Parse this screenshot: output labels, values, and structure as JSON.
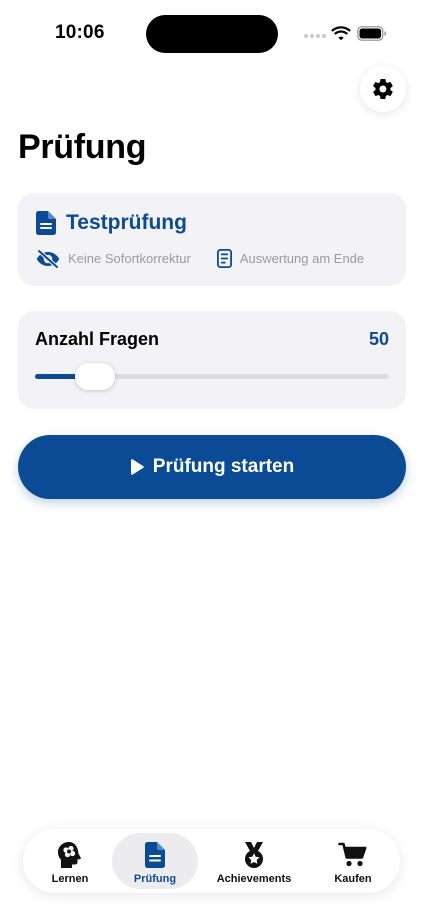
{
  "status_bar": {
    "time": "10:06"
  },
  "page": {
    "title": "Prüfung"
  },
  "exam_card": {
    "title": "Testprüfung",
    "meta": [
      {
        "icon": "eye-slash-icon",
        "label": "Keine Sofortkorrektur"
      },
      {
        "icon": "document-list-icon",
        "label": "Auswertung am Ende"
      }
    ]
  },
  "question_count": {
    "label": "Anzahl Fragen",
    "value": "50",
    "slider_fraction": 0.17
  },
  "start_button": {
    "label": "Prüfung starten"
  },
  "tab_bar": {
    "tabs": [
      {
        "label": "Lernen",
        "icon": "brain-head-icon",
        "active": false
      },
      {
        "label": "Prüfung",
        "icon": "document-icon",
        "active": true
      },
      {
        "label": "Achievements",
        "icon": "medal-icon",
        "active": false
      },
      {
        "label": "Kaufen",
        "icon": "cart-icon",
        "active": false
      }
    ]
  },
  "colors": {
    "accent": "#0b4a94",
    "card": "#f2f2f7",
    "muted": "#9a9aa0"
  }
}
